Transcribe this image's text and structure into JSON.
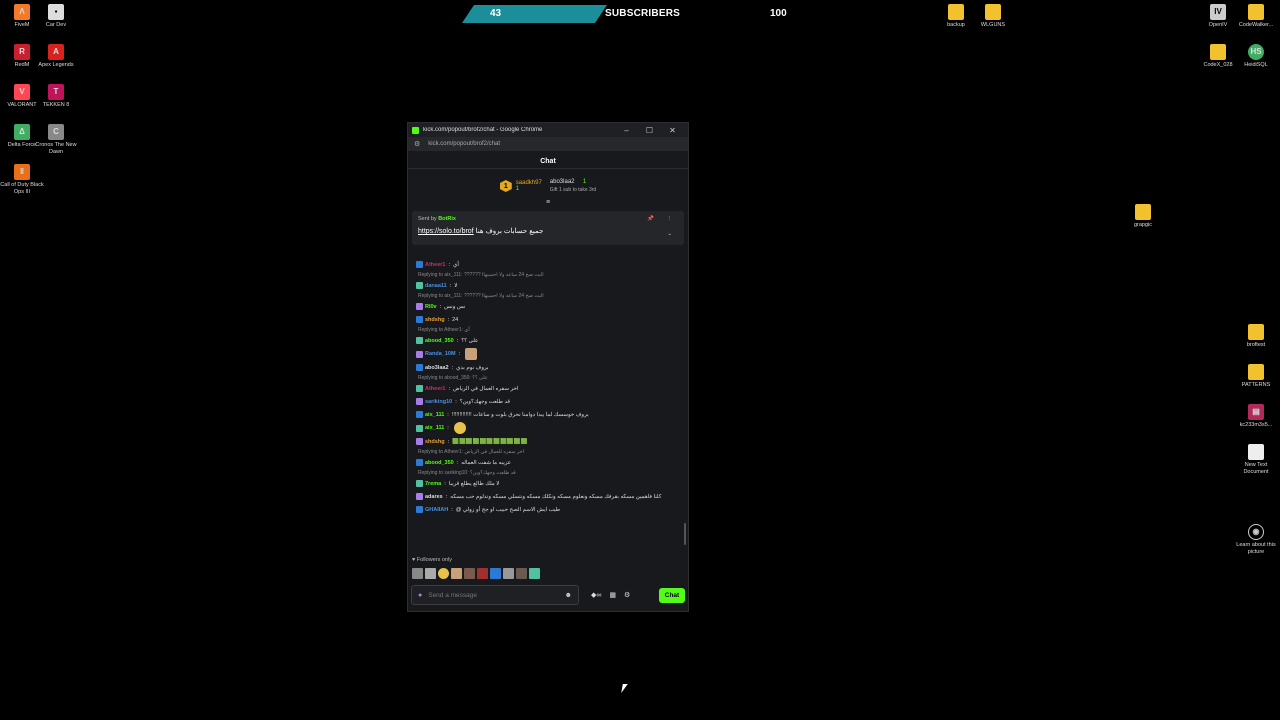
{
  "desktop_icons": [
    {
      "label": "FiveM",
      "icon": "fivem-icon",
      "color": "#f27a2b"
    },
    {
      "label": "Car Dev",
      "icon": "car-dev-icon",
      "color": "#dddddd"
    },
    {
      "label": "RedM",
      "icon": "redm-icon",
      "color": "#c8202f"
    },
    {
      "label": "Apex Legends",
      "icon": "apex-icon",
      "color": "#d6231e"
    },
    {
      "label": "VALORANT",
      "icon": "valorant-icon",
      "color": "#ff4655"
    },
    {
      "label": "TEKKEN 8",
      "icon": "tekken-icon",
      "color": "#c0145a"
    },
    {
      "label": "Delta Force",
      "icon": "delta-force-icon",
      "color": "#3fae63"
    },
    {
      "label": "Cronos The New Dawn",
      "icon": "cronos-icon",
      "color": "#888888"
    },
    {
      "label": "Call of Duty Black Ops III",
      "icon": "cod-icon",
      "color": "#e8701a"
    },
    {
      "label": "backup",
      "icon": "folder-icon"
    },
    {
      "label": "WLGUNS",
      "icon": "folder-icon"
    },
    {
      "label": "OpenIV",
      "icon": "openiv-icon",
      "color": "#cccccc"
    },
    {
      "label": "CodeWalker...",
      "icon": "folder-icon"
    },
    {
      "label": "CodeX_028",
      "icon": "folder-icon"
    },
    {
      "label": "HeidiSQL",
      "icon": "heidisql-icon",
      "color": "#3fae63"
    },
    {
      "label": "grapgic",
      "icon": "folder-icon"
    },
    {
      "label": "broftest",
      "icon": "folder-icon"
    },
    {
      "label": "PATTERNS",
      "icon": "folder-icon"
    },
    {
      "label": "kc233m3s5...",
      "icon": "archive-icon",
      "color": "#b02a5a"
    },
    {
      "label": "New Text Document",
      "icon": "text-document-icon"
    },
    {
      "label": "Learn about this picture",
      "icon": "camera-icon"
    }
  ],
  "overlay": {
    "count": "43",
    "label": "SUBSCRIBERS",
    "goal": "100",
    "progress": 0.43,
    "accent": "#1b8e99"
  },
  "window": {
    "title": "kick.com/popout/brof2/chat - Google Chrome",
    "url": "kick.com/popout/brof2/chat",
    "minimize": "–",
    "maximize": "☐",
    "close": "✕"
  },
  "chat": {
    "header": "Chat",
    "top_gifters": [
      {
        "rank": "1",
        "name": "saadkh97",
        "count": "1"
      },
      {
        "name": "abo3laa2",
        "count": "1",
        "hint": "Gift 1 sub to take 3rd"
      }
    ],
    "pinned": {
      "sent_by_prefix": "Sent by",
      "sender": "BotRix",
      "link": "https://solo.to/brof",
      "text": "جميع حسابات بروف هنا"
    },
    "messages": [
      {
        "reply": "",
        "user": "Atheer1",
        "user_color": "#e0245e",
        "text": "أي"
      },
      {
        "reply": "Replying to aix_111: ?????? البت صح 24 ساعه ولا احسبهاا",
        "user": "danaa11",
        "user_color": "#4a90e2",
        "text": "لا"
      },
      {
        "reply": "Replying to aix_111: ?????? البت صح 24 ساعه ولا احسبهاا",
        "user": "Rl0v",
        "user_color": "#53fc18",
        "text": "نس ونس"
      },
      {
        "reply": "",
        "user": "shdshg",
        "user_color": "#f0a030",
        "text": "24"
      },
      {
        "reply": "Replying to Atheer1: أي",
        "user": "abood_350",
        "user_color": "#53fc18",
        "text": "على ؟؟"
      },
      {
        "reply": "",
        "user": "Randa_10M",
        "user_color": "#4a90e2",
        "text": ""
      },
      {
        "reply": "",
        "user": "abo3laa2",
        "user_color": "#dddddd",
        "text": "بروف نوم بدي"
      },
      {
        "reply": "Replying to abood_350: على ؟؟",
        "user": "Atheer1",
        "user_color": "#e0245e",
        "text": "اخر سفره العمال في الرياض"
      },
      {
        "reply": "",
        "user": "sariking10",
        "user_color": "#4a90e2",
        "text": "قد طلعت وجهك؟وين؟"
      },
      {
        "reply": "",
        "user": "aix_111",
        "user_color": "#53fc18",
        "text": "!!!!!!!!!!!!! بروف خوسسك لما يبدا دوامنا نحرق بلوت و ساعات"
      },
      {
        "reply": "",
        "user": "aix_111",
        "user_color": "#53fc18",
        "text": ""
      },
      {
        "reply": "",
        "user": "shdshg",
        "user_color": "#f0a030",
        "text": "🟩🟩🟩🟩🟩🟩🟩🟩🟩🟩🟩"
      },
      {
        "reply": "Replying to Atheer1: اخر سفره للعمال في الرياض",
        "user": "abood_350",
        "user_color": "#53fc18",
        "text": "عزيبه ما شفت العماله"
      },
      {
        "reply": "Replying to sariking10: قد طلعت وجهك؟وين؟",
        "user": "7rema",
        "user_color": "#53fc18",
        "text": "لا ملك طالع يطلع قريبا"
      },
      {
        "reply": "",
        "user": "adares",
        "user_color": "#dddddd",
        "text": "كلنا فاهمين مسكه بقرفك مسكه ونعلوم مسكه ونكلك مسكه ونتسلي مسكه وندلوم حب مسكه"
      },
      {
        "reply": "",
        "user": "GHAIIAH",
        "user_color": "#4a90e2",
        "text": "@ طيب ايش الاسم الصح حبيب او جج أو زولي"
      }
    ],
    "followers_only": "Followers only",
    "input_placeholder": "Send a message",
    "send_label": "Chat"
  }
}
